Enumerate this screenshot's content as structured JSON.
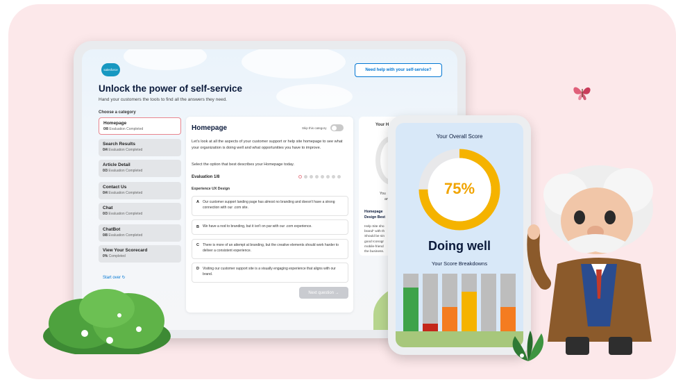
{
  "app": {
    "logo_text": "salesforce",
    "help_button": "Need help with your self-service?",
    "title": "Unlock the power of self-service",
    "subtitle": "Hand your customers the tools to find all the answers they need.",
    "category_heading": "Choose a category",
    "start_over": "Start over ↻"
  },
  "categories": [
    {
      "name": "Homepage",
      "count": "0/8",
      "status": "Evaluation Completed",
      "active": true
    },
    {
      "name": "Search Results",
      "count": "0/4",
      "status": "Evaluation Completed"
    },
    {
      "name": "Article Detail",
      "count": "0/3",
      "status": "Evaluation Completed"
    },
    {
      "name": "Contact Us",
      "count": "0/4",
      "status": "Evaluation Completed"
    },
    {
      "name": "Chat",
      "count": "0/3",
      "status": "Evaluation Completed"
    },
    {
      "name": "ChatBot",
      "count": "0/8",
      "status": "Evaluation Completed"
    },
    {
      "name": "View Your Scorecard",
      "count": "0%",
      "status": "Completed"
    }
  ],
  "main": {
    "title": "Homepage",
    "skip_label": "Skip this category",
    "description": "Let's look at all the aspects of your customer support or help site homepage to see what your organization is doing well and what opportunities you have to improve.",
    "select_prompt": "Select the option that best describes your Homepage today.",
    "evaluation_label": "Evaluation 1/8",
    "evaluation_current": 1,
    "evaluation_total": 8,
    "section_label": "Experience UX Design",
    "options": [
      {
        "letter": "A",
        "text": "Our customer support landing page has almost no branding and doesn't have a strong connection with our .com site."
      },
      {
        "letter": "B",
        "text": "We have a nod to branding, but it isn't on par with our .com experience."
      },
      {
        "letter": "C",
        "text": "There is more of an attempt at branding, but the creative elements should work harder to deliver a consistent experience."
      },
      {
        "letter": "D",
        "text": "Visiting our customer support site is a visually engaging experience that aligns with our brand."
      }
    ],
    "next_button": "Next question →"
  },
  "score_mini": {
    "title": "Your H",
    "you_line1": "You",
    "you_line2": "an",
    "heading_line1": "Homepage",
    "heading_line2": "Design Best",
    "body_lines": [
      "Help Site sho",
      "brand\" with th",
      "Should be sin",
      "good Iconogr",
      "mobile-friend",
      "the business."
    ]
  },
  "phone": {
    "title": "Your Overall Score",
    "percent_label": "75%",
    "percent": 75,
    "verdict": "Doing well",
    "breakdown_title": "Your Score Breakdowns",
    "breakdown_bars": [
      {
        "fill": 0.78,
        "color": "#3ea34a"
      },
      {
        "fill": 0.22,
        "color": "#c4271b"
      },
      {
        "fill": 0.48,
        "color": "#f47c20"
      },
      {
        "fill": 0.72,
        "color": "#f5b300"
      },
      {
        "fill": 0.0,
        "color": "#f47c20"
      },
      {
        "fill": 0.48,
        "color": "#f47c20"
      }
    ]
  },
  "colors": {
    "brand_blue": "#0176d3",
    "gauge_color": "#f5b300",
    "background": "#fce8ea"
  }
}
